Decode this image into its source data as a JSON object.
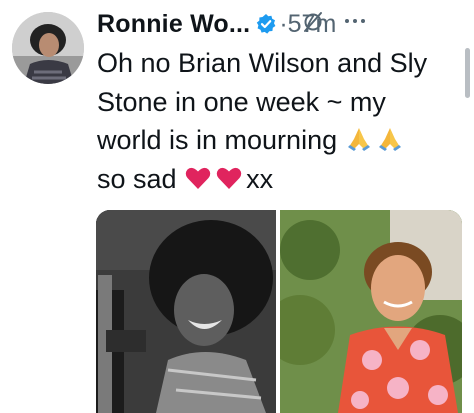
{
  "tweet": {
    "author_name": "Ronnie Wo...",
    "time_ago": "·57m",
    "text_lines": [
      "Oh no Brian Wilson and Sly",
      "Stone in one week ~ my",
      "world is in mourning",
      "so sad",
      "xx"
    ]
  },
  "icons": {
    "verified": "verified-badge-icon",
    "grok": "grok-icon",
    "more": "more-icon",
    "pray": "folded-hands-emoji",
    "heart": "red-heart-emoji"
  },
  "colors": {
    "verified_blue": "#1d9bf0",
    "text_primary": "#0f1419",
    "text_secondary": "#536471",
    "heart_red": "#e0245e"
  }
}
